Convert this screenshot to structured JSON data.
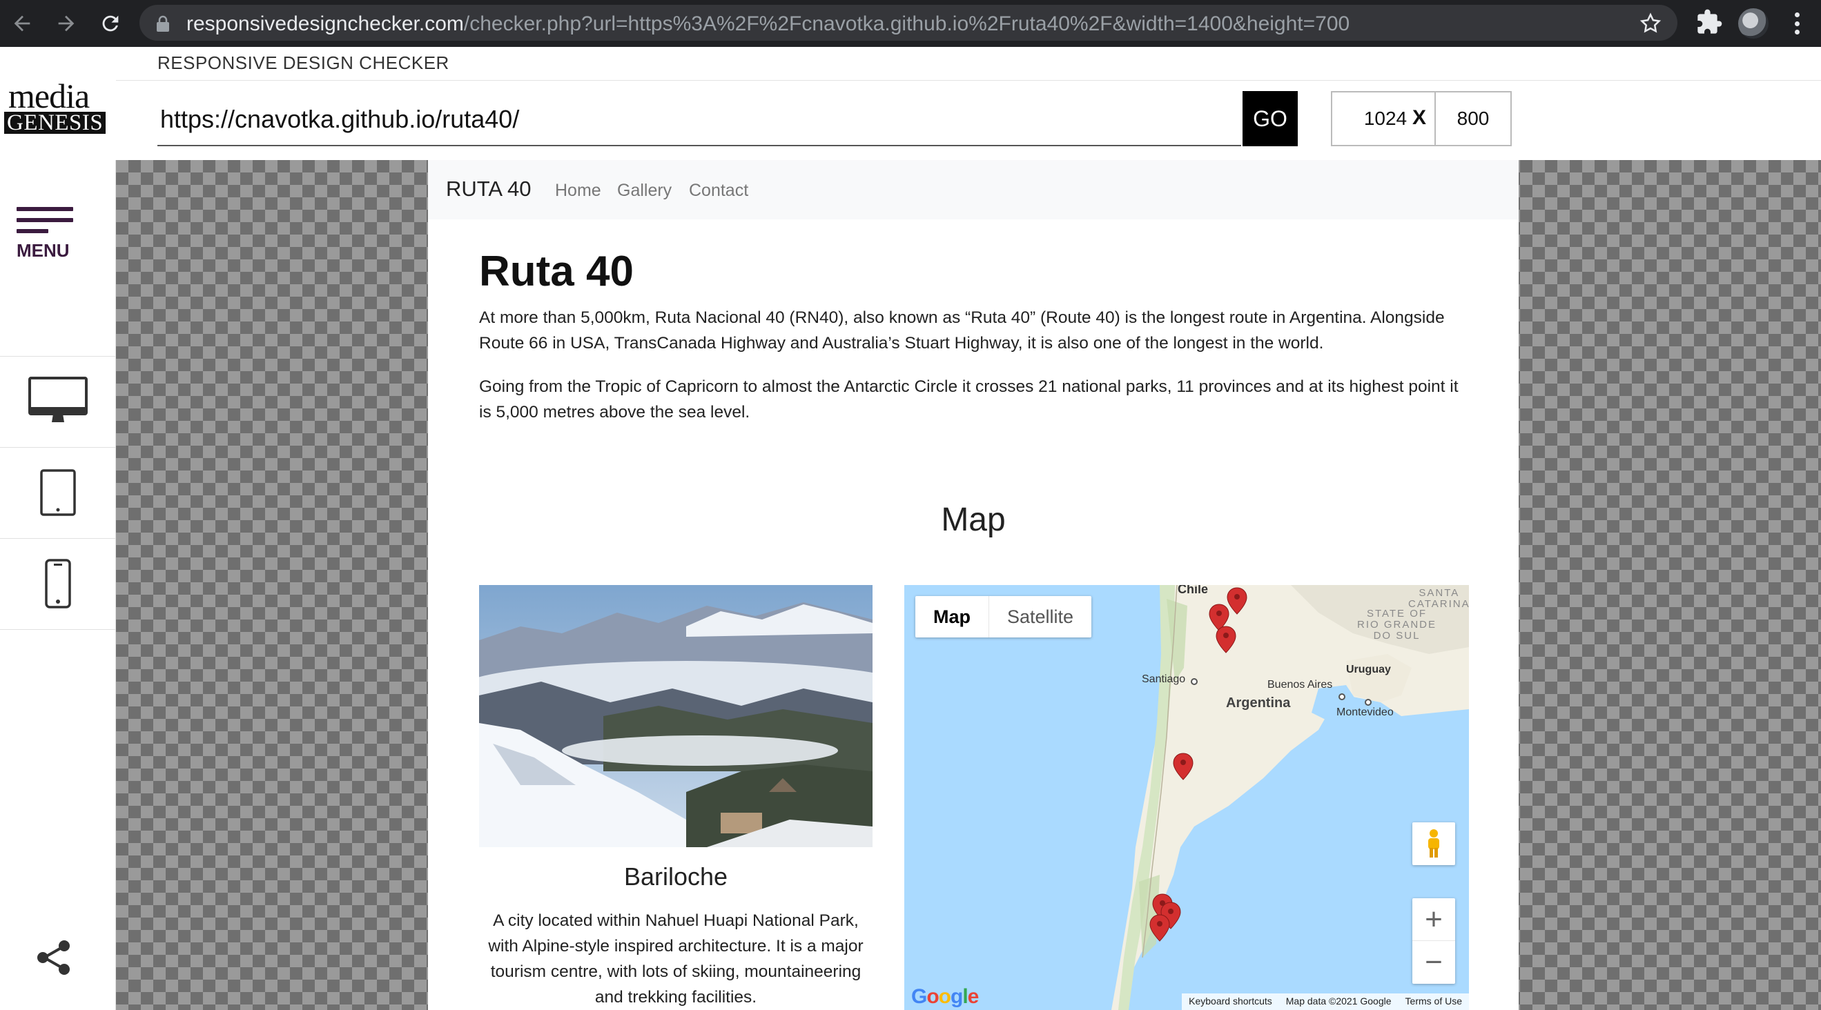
{
  "browser": {
    "url_host": "responsivedesignchecker.com",
    "url_path": "/checker.php?url=https%3A%2F%2Fcnavotka.github.io%2Fruta40%2F&width=1400&height=700"
  },
  "checker": {
    "title": "RESPONSIVE DESIGN CHECKER",
    "logo_line1": "media",
    "logo_line2": "GENESIS",
    "url_value": "https://cnavotka.github.io/ruta40/",
    "go_label": "GO",
    "width_value": "1024",
    "times_label": "X",
    "height_value": "800",
    "menu_label": "MENU"
  },
  "site": {
    "brand": "RUTA 40",
    "nav": [
      "Home",
      "Gallery",
      "Contact"
    ],
    "heading": "Ruta 40",
    "paragraph1": "At more than 5,000km, Ruta Nacional 40 (RN40), also known as “Ruta 40” (Route 40) is the longest route in Argentina. Alongside Route 66 in USA, TransCanada Highway and Australia’s Stuart Highway, it is also one of the longest in the world.",
    "paragraph2": "Going from the Tropic of Capricorn to almost the Antarctic Circle it crosses 21 national parks, 11 provinces and at its highest point it is 5,000 metres above the sea level.",
    "map_heading": "Map",
    "card": {
      "title": "Bariloche",
      "text": "A city located within Nahuel Huapi National Park, with Alpine-style inspired architecture. It is a major tourism centre, with lots of skiing, mountaineering and trekking facilities."
    }
  },
  "map": {
    "type_map": "Map",
    "type_satellite": "Satellite",
    "labels": {
      "chile": "Chile",
      "santiago": "Santiago",
      "argentina": "Argentina",
      "buenos_aires": "Buenos Aires",
      "uruguay": "Uruguay",
      "montevideo": "Montevideo",
      "santa_catarina": "SANTA\nCATARINA",
      "rio_grande": "STATE OF\nRIO GRANDE\nDO SUL"
    },
    "zoom_in": "+",
    "zoom_out": "−",
    "google": "Google",
    "footer": [
      "Keyboard shortcuts",
      "Map data ©2021 Google",
      "Terms of Use"
    ]
  },
  "colors": {
    "chrome_bg": "#202124",
    "brand_purple": "#3b1b3f",
    "marker_red": "#d32f2f",
    "water": "#aadaff",
    "land": "#f2efe3"
  }
}
